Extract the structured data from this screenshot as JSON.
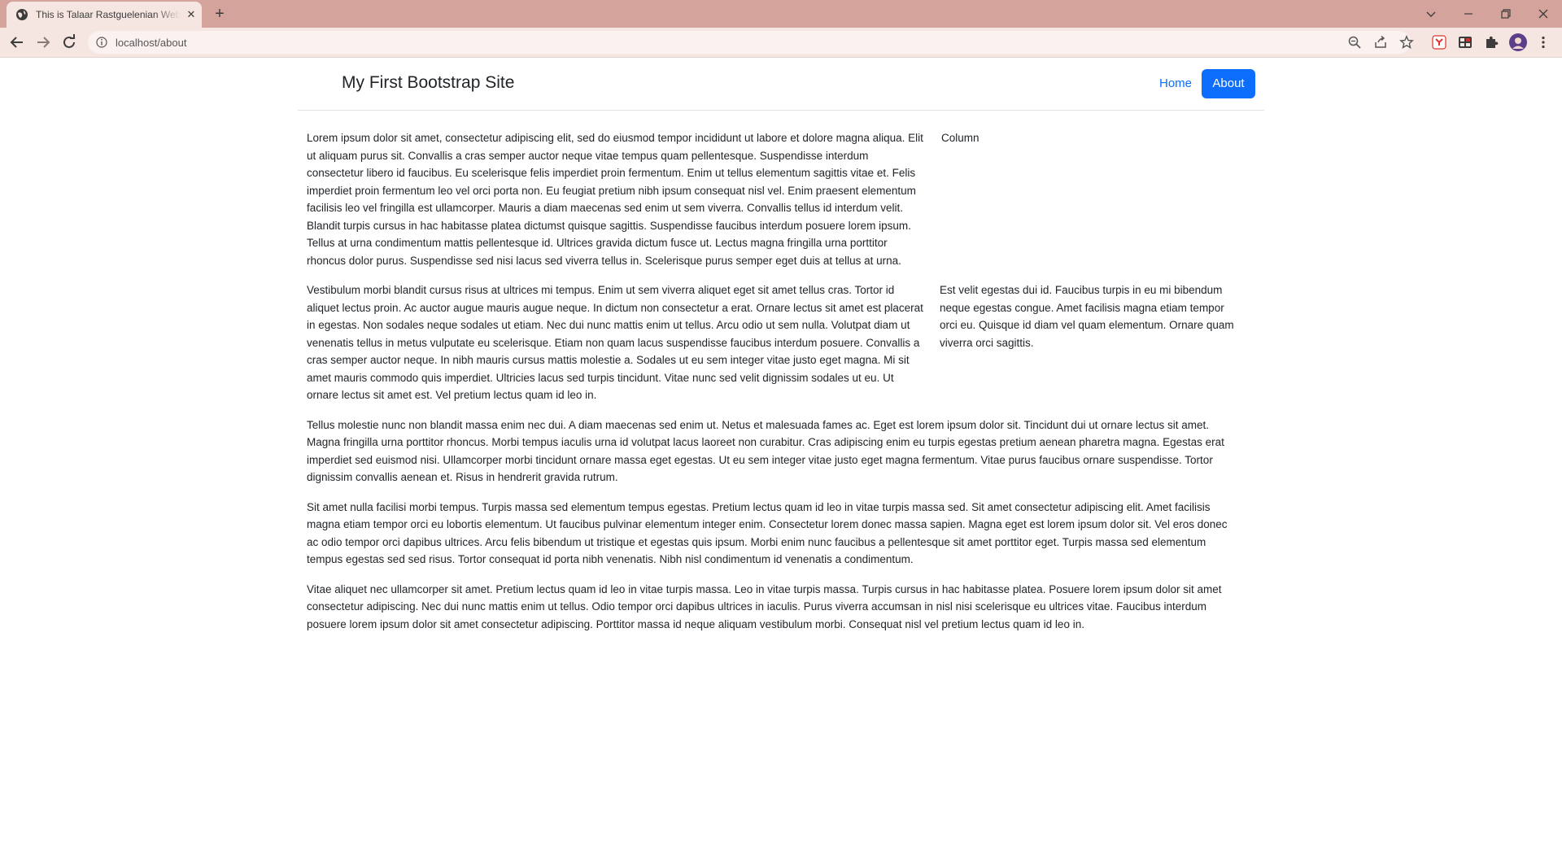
{
  "browser": {
    "tab_title": "This is Talaar Rastguelenian Website",
    "tab_close": "✕",
    "new_tab": "+",
    "url": "localhost/about",
    "icons": {
      "tab_icon": "globe-icon",
      "tab_search": "chevron-down-icon",
      "minimize": "minimize-icon",
      "restore": "restore-icon",
      "close": "close-icon",
      "back": "back-arrow-icon",
      "forward": "forward-arrow-icon",
      "reload": "reload-icon",
      "info": "info-icon",
      "zoom": "zoom-icon",
      "share": "share-icon",
      "bookmark": "star-icon",
      "ext1": "extension-shield-icon",
      "ext2": "extension-grid-icon",
      "extensions": "puzzle-icon",
      "profile": "avatar-icon",
      "menu": "kebab-menu-icon"
    },
    "colors": {
      "frame": "#d4a39b",
      "toolbar": "#f6e6e2"
    }
  },
  "site": {
    "title": "My First Bootstrap Site",
    "nav": {
      "home": "Home",
      "about": "About"
    },
    "colors": {
      "primary": "#0d6efd",
      "text": "#212529"
    }
  },
  "content": {
    "row1": {
      "main": "Lorem ipsum dolor sit amet, consectetur adipiscing elit, sed do eiusmod tempor incididunt ut labore et dolore magna aliqua. Elit ut aliquam purus sit. Convallis a cras semper auctor neque vitae tempus quam pellentesque. Suspendisse interdum consectetur libero id faucibus. Eu scelerisque felis imperdiet proin fermentum. Enim ut tellus elementum sagittis vitae et. Felis imperdiet proin fermentum leo vel orci porta non. Eu feugiat pretium nibh ipsum consequat nisl vel. Enim praesent elementum facilisis leo vel fringilla est ullamcorper. Mauris a diam maecenas sed enim ut sem viverra. Convallis tellus id interdum velit. Blandit turpis cursus in hac habitasse platea dictumst quisque sagittis. Suspendisse faucibus interdum posuere lorem ipsum. Tellus at urna condimentum mattis pellentesque id. Ultrices gravida dictum fusce ut. Lectus magna fringilla urna porttitor rhoncus dolor purus. Suspendisse sed nisi lacus sed viverra tellus in. Scelerisque purus semper eget duis at tellus at urna.",
      "side": "Column"
    },
    "row2": {
      "main": "Vestibulum morbi blandit cursus risus at ultrices mi tempus. Enim ut sem viverra aliquet eget sit amet tellus cras. Tortor id aliquet lectus proin. Ac auctor augue mauris augue neque. In dictum non consectetur a erat. Ornare lectus sit amet est placerat in egestas. Non sodales neque sodales ut etiam. Nec dui nunc mattis enim ut tellus. Arcu odio ut sem nulla. Volutpat diam ut venenatis tellus in metus vulputate eu scelerisque. Etiam non quam lacus suspendisse faucibus interdum posuere. Convallis a cras semper auctor neque. In nibh mauris cursus mattis molestie a. Sodales ut eu sem integer vitae justo eget magna. Mi sit amet mauris commodo quis imperdiet. Ultricies lacus sed turpis tincidunt. Vitae nunc sed velit dignissim sodales ut eu. Ut ornare lectus sit amet est. Vel pretium lectus quam id leo in.",
      "side": "Est velit egestas dui id. Faucibus turpis in eu mi bibendum neque egestas congue. Amet facilisis magna etiam tempor orci eu. Quisque id diam vel quam elementum. Ornare quam viverra orci sagittis."
    },
    "paragraphs": [
      "Tellus molestie nunc non blandit massa enim nec dui. A diam maecenas sed enim ut. Netus et malesuada fames ac. Eget est lorem ipsum dolor sit. Tincidunt dui ut ornare lectus sit amet. Magna fringilla urna porttitor rhoncus. Morbi tempus iaculis urna id volutpat lacus laoreet non curabitur. Cras adipiscing enim eu turpis egestas pretium aenean pharetra magna. Egestas erat imperdiet sed euismod nisi. Ullamcorper morbi tincidunt ornare massa eget egestas. Ut eu sem integer vitae justo eget magna fermentum. Vitae purus faucibus ornare suspendisse. Tortor dignissim convallis aenean et. Risus in hendrerit gravida rutrum.",
      "Sit amet nulla facilisi morbi tempus. Turpis massa sed elementum tempus egestas. Pretium lectus quam id leo in vitae turpis massa sed. Sit amet consectetur adipiscing elit. Amet facilisis magna etiam tempor orci eu lobortis elementum. Ut faucibus pulvinar elementum integer enim. Consectetur lorem donec massa sapien. Magna eget est lorem ipsum dolor sit. Vel eros donec ac odio tempor orci dapibus ultrices. Arcu felis bibendum ut tristique et egestas quis ipsum. Morbi enim nunc faucibus a pellentesque sit amet porttitor eget. Turpis massa sed elementum tempus egestas sed sed risus. Tortor consequat id porta nibh venenatis. Nibh nisl condimentum id venenatis a condimentum.",
      "Vitae aliquet nec ullamcorper sit amet. Pretium lectus quam id leo in vitae turpis massa. Leo in vitae turpis massa. Turpis cursus in hac habitasse platea. Posuere lorem ipsum dolor sit amet consectetur adipiscing. Nec dui nunc mattis enim ut tellus. Odio tempor orci dapibus ultrices in iaculis. Purus viverra accumsan in nisl nisi scelerisque eu ultrices vitae. Faucibus interdum posuere lorem ipsum dolor sit amet consectetur adipiscing. Porttitor massa id neque aliquam vestibulum morbi. Consequat nisl vel pretium lectus quam id leo in."
    ]
  }
}
